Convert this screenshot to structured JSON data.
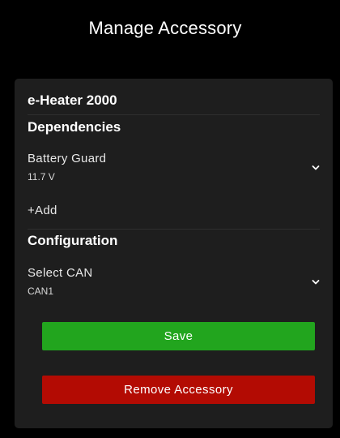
{
  "header": {
    "title": "Manage Accessory"
  },
  "accessory": {
    "name": "e-Heater 2000"
  },
  "dependencies": {
    "heading": "Dependencies",
    "items": [
      {
        "label": "Battery Guard",
        "value": "11.7 V",
        "icon": "chevron-down-icon"
      }
    ],
    "add_label": "+Add"
  },
  "configuration": {
    "heading": "Configuration",
    "select_can": {
      "label": "Select CAN",
      "value": "CAN1",
      "icon": "chevron-down-icon"
    }
  },
  "actions": {
    "save_label": "Save",
    "remove_label": "Remove Accessory"
  },
  "colors": {
    "background": "#000000",
    "card": "#1e1e1e",
    "save": "#22a51e",
    "remove": "#b30b03"
  }
}
